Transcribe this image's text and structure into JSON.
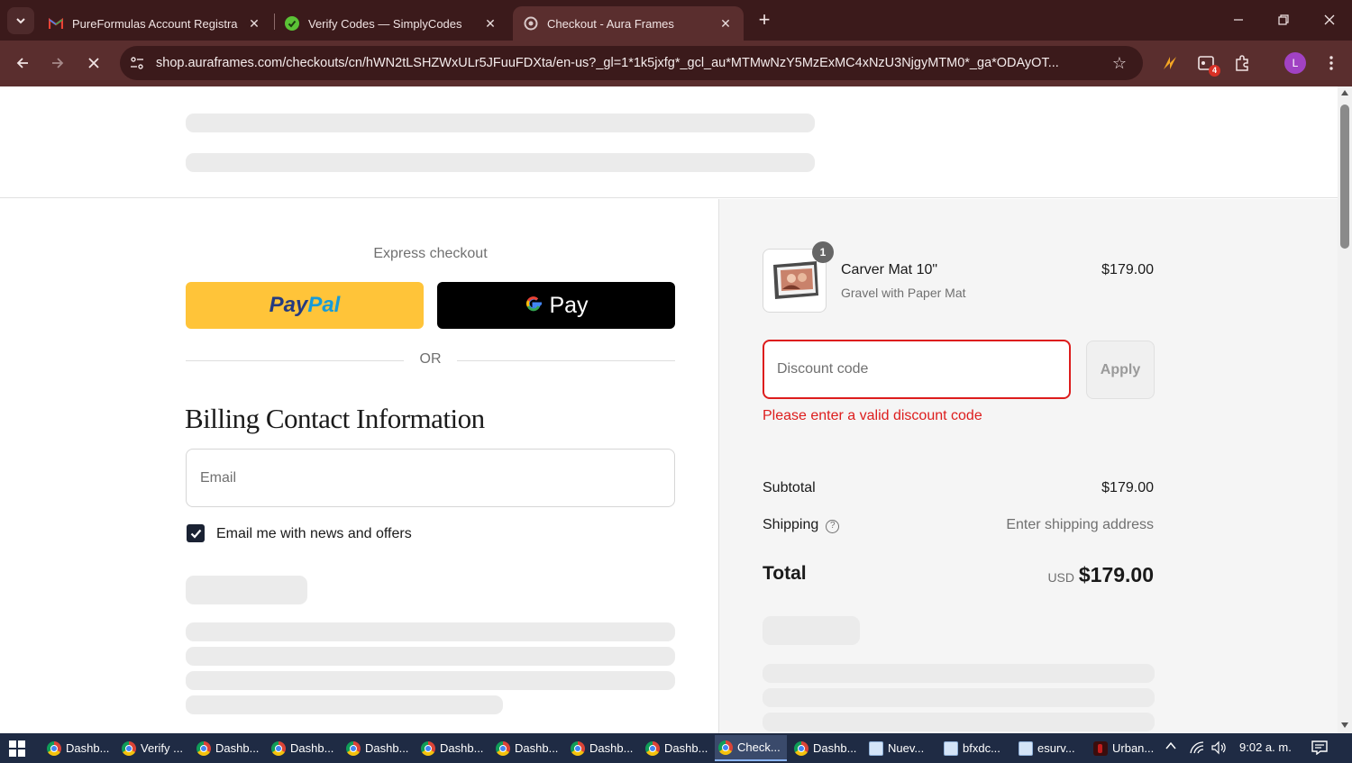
{
  "browser": {
    "tabs": [
      {
        "title": "PureFormulas Account Registra",
        "favicon": "gmail-icon",
        "active": false
      },
      {
        "title": "Verify Codes — SimplyCodes",
        "favicon": "simplycodes-icon",
        "active": false
      },
      {
        "title": "Checkout - Aura Frames",
        "favicon": "aura-icon",
        "active": true
      }
    ],
    "url": "shop.auraframes.com/checkouts/cn/hWN2tLSHZWxULr5JFuuFDXta/en-us?_gl=1*1k5jxfg*_gcl_au*MTMwNzY5MzExMC4xNzU3NjgyMTM0*_ga*ODAyOT...",
    "extension_badge": "4",
    "profile_initial": "L"
  },
  "express": {
    "label": "Express checkout",
    "paypal_a": "Pay",
    "paypal_b": "Pal",
    "gpay_g": "G",
    "gpay_text": "Pay",
    "or_text": "OR"
  },
  "billing": {
    "title": "Billing Contact Information",
    "email_placeholder": "Email",
    "newsletter_label": "Email me with news and offers",
    "newsletter_checked": true
  },
  "order": {
    "quantity": "1",
    "product_name": "Carver Mat 10\"",
    "product_variant": "Gravel with Paper Mat",
    "product_price": "$179.00",
    "discount_placeholder": "Discount code",
    "apply_label": "Apply",
    "discount_error": "Please enter a valid discount code",
    "subtotal_label": "Subtotal",
    "subtotal_value": "$179.00",
    "shipping_label": "Shipping",
    "shipping_value": "Enter shipping address",
    "total_label": "Total",
    "total_currency": "USD",
    "total_value": "$179.00"
  },
  "taskbar": {
    "items": [
      {
        "label": "Dashb...",
        "icon": "chrome-icon"
      },
      {
        "label": "Verify ...",
        "icon": "chrome-icon"
      },
      {
        "label": "Dashb...",
        "icon": "chrome-icon"
      },
      {
        "label": "Dashb...",
        "icon": "chrome-icon"
      },
      {
        "label": "Dashb...",
        "icon": "chrome-icon"
      },
      {
        "label": "Dashb...",
        "icon": "chrome-icon"
      },
      {
        "label": "Dashb...",
        "icon": "chrome-icon"
      },
      {
        "label": "Dashb...",
        "icon": "chrome-icon"
      },
      {
        "label": "Dashb...",
        "icon": "chrome-icon"
      },
      {
        "label": "Check...",
        "icon": "chrome-icon"
      },
      {
        "label": "Dashb...",
        "icon": "chrome-icon"
      },
      {
        "label": "Nuev...",
        "icon": "notepad-icon"
      },
      {
        "label": "bfxdc...",
        "icon": "notepad-icon"
      },
      {
        "label": "esurv...",
        "icon": "notepad-icon"
      },
      {
        "label": "Urban...",
        "icon": "app-icon"
      }
    ],
    "clock": "9:02 a. m."
  },
  "colors": {
    "chrome_tabbar": "#3b1a1b",
    "chrome_toolbar": "#5a2e2e",
    "paypal_yellow": "#ffc439",
    "error_red": "#dd1d1d",
    "summary_bg": "#f5f5f5",
    "taskbar": "#1f2b44"
  }
}
